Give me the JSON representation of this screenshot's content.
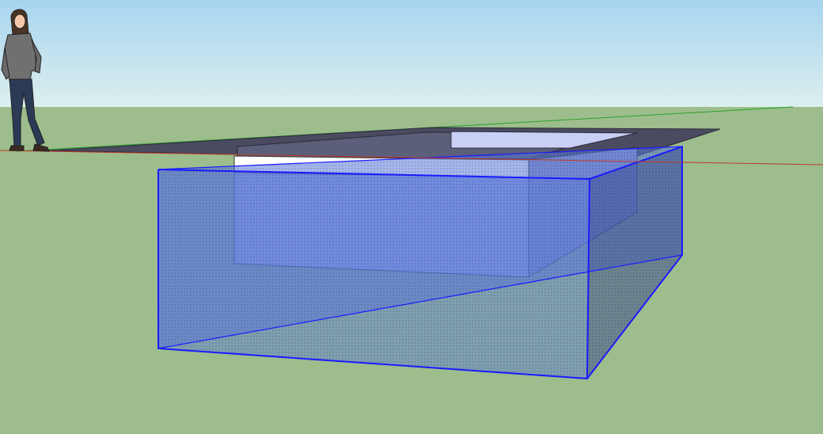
{
  "viewport": {
    "colors": {
      "sky_top": "#a8d4f0",
      "sky_bottom": "#dcefee",
      "ground": "#9dbd8d",
      "red_axis": "#c0392b",
      "green_axis": "#2ca02c",
      "selection": "#1a1aff",
      "selection_fill": "#5a7ad8",
      "slab": "#4a4a60",
      "slab_top": "#3a3a4e",
      "white_band": "#ffffff",
      "inner_wall": "#b7c0ee"
    }
  },
  "scene": {
    "scale_figure": "person",
    "selected_object": "box",
    "axes": [
      "red",
      "green"
    ]
  }
}
